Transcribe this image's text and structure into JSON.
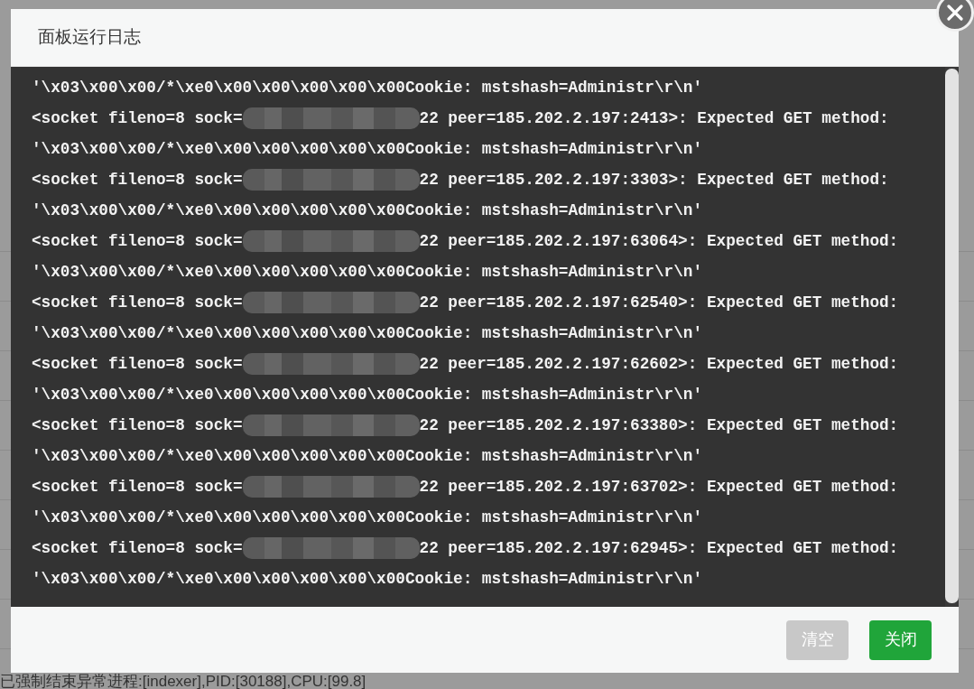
{
  "background_rows": [
    {
      "text": "已强制结束异常进程:[indexer],PID:[30188],CPU:[99.8]"
    }
  ],
  "dialog": {
    "title": "面板运行日志",
    "log_lines": [
      {
        "kind": "payload",
        "text": "'\\x03\\x00\\x00/*\\xe0\\x00\\x00\\x00\\x00\\x00Cookie: mstshash=Administr\\r\\n'"
      },
      {
        "kind": "socket",
        "prefix": "<socket fileno=8 sock=",
        "suffix": "22 peer=185.202.2.197:2413>: Expected GET method:"
      },
      {
        "kind": "payload",
        "text": "'\\x03\\x00\\x00/*\\xe0\\x00\\x00\\x00\\x00\\x00Cookie: mstshash=Administr\\r\\n'"
      },
      {
        "kind": "socket",
        "prefix": "<socket fileno=8 sock=",
        "suffix": "22 peer=185.202.2.197:3303>: Expected GET method:"
      },
      {
        "kind": "payload",
        "text": "'\\x03\\x00\\x00/*\\xe0\\x00\\x00\\x00\\x00\\x00Cookie: mstshash=Administr\\r\\n'"
      },
      {
        "kind": "socket",
        "prefix": "<socket fileno=8 sock=",
        "suffix": "22 peer=185.202.2.197:63064>: Expected GET method:"
      },
      {
        "kind": "payload",
        "text": "'\\x03\\x00\\x00/*\\xe0\\x00\\x00\\x00\\x00\\x00Cookie: mstshash=Administr\\r\\n'"
      },
      {
        "kind": "socket",
        "prefix": "<socket fileno=8 sock=",
        "suffix": "22 peer=185.202.2.197:62540>: Expected GET method:"
      },
      {
        "kind": "payload",
        "text": "'\\x03\\x00\\x00/*\\xe0\\x00\\x00\\x00\\x00\\x00Cookie: mstshash=Administr\\r\\n'"
      },
      {
        "kind": "socket",
        "prefix": "<socket fileno=8 sock=",
        "suffix": "22 peer=185.202.2.197:62602>: Expected GET method:"
      },
      {
        "kind": "payload",
        "text": "'\\x03\\x00\\x00/*\\xe0\\x00\\x00\\x00\\x00\\x00Cookie: mstshash=Administr\\r\\n'"
      },
      {
        "kind": "socket",
        "prefix": "<socket fileno=8 sock=",
        "suffix": "22 peer=185.202.2.197:63380>: Expected GET method:"
      },
      {
        "kind": "payload",
        "text": "'\\x03\\x00\\x00/*\\xe0\\x00\\x00\\x00\\x00\\x00Cookie: mstshash=Administr\\r\\n'"
      },
      {
        "kind": "socket",
        "prefix": "<socket fileno=8 sock=",
        "suffix": "22 peer=185.202.2.197:63702>: Expected GET method:"
      },
      {
        "kind": "payload",
        "text": "'\\x03\\x00\\x00/*\\xe0\\x00\\x00\\x00\\x00\\x00Cookie: mstshash=Administr\\r\\n'"
      },
      {
        "kind": "socket",
        "prefix": "<socket fileno=8 sock=",
        "suffix": "22 peer=185.202.2.197:62945>: Expected GET method:"
      },
      {
        "kind": "payload",
        "text": "'\\x03\\x00\\x00/*\\xe0\\x00\\x00\\x00\\x00\\x00Cookie: mstshash=Administr\\r\\n'"
      }
    ],
    "buttons": [
      {
        "label": "清空",
        "kind": "secondary"
      },
      {
        "label": "关闭",
        "kind": "primary"
      }
    ]
  }
}
